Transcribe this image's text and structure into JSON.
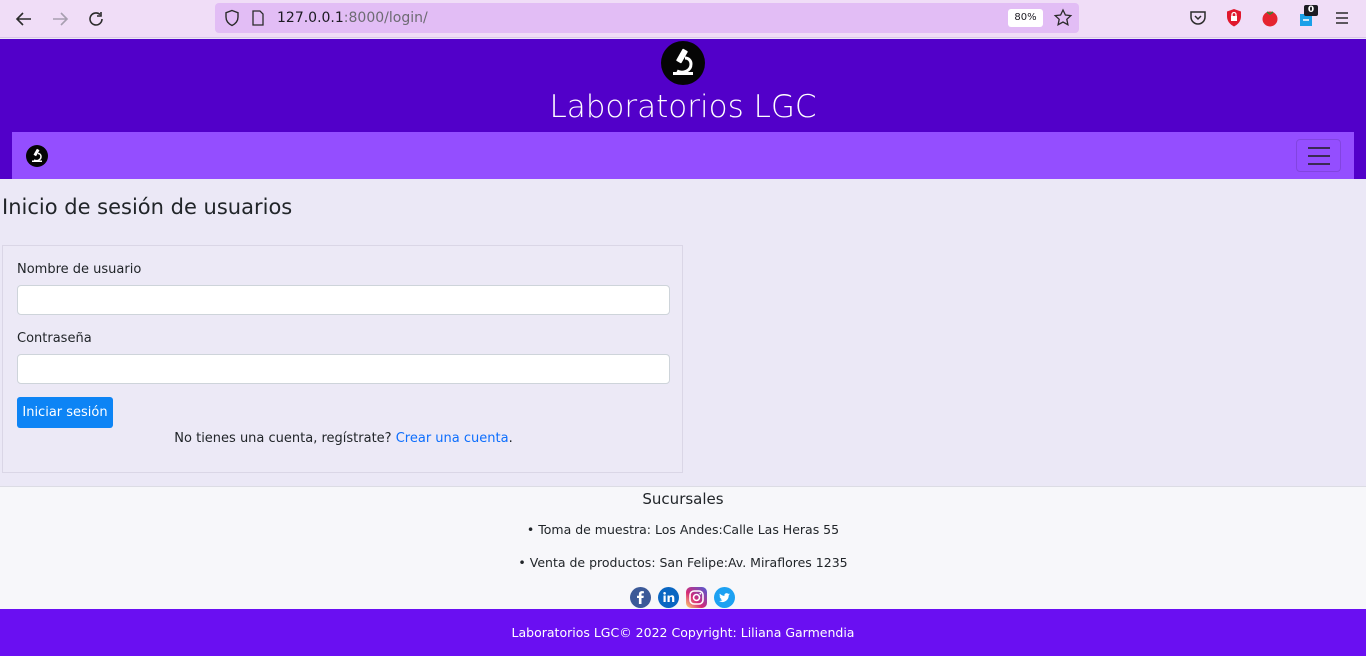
{
  "browser": {
    "url_host": "127.0.0.1",
    "url_rest": ":8000/login/",
    "zoom": "80%",
    "extension_badge": "0"
  },
  "header": {
    "title": "Laboratorios LGC"
  },
  "main": {
    "title": "Inicio de sesión de usuarios",
    "username_label": "Nombre de usuario",
    "username_value": "",
    "password_label": "Contraseña",
    "password_value": "",
    "submit_label": "Iniciar sesión",
    "register_prompt": "No tienes una cuenta, regístrate?",
    "register_link": "Crear una cuenta",
    "register_end": "."
  },
  "footer": {
    "branches_title": "Sucursales",
    "branches": [
      "• Toma de muestra: Los Andes:Calle Las Heras 55",
      "• Venta de productos: San Felipe:Av. Miraflores 1235"
    ],
    "social": [
      "facebook-icon",
      "linkedin-icon",
      "instagram-icon",
      "twitter-icon"
    ],
    "copyright": "Laboratorios LGC© 2022 Copyright: Liliana Garmendia"
  },
  "colors": {
    "header_bg": "#5200c9",
    "navbar_bg": "#944eff",
    "primary_button": "#0d84f5",
    "bottom_bar": "#6a0ff2"
  }
}
